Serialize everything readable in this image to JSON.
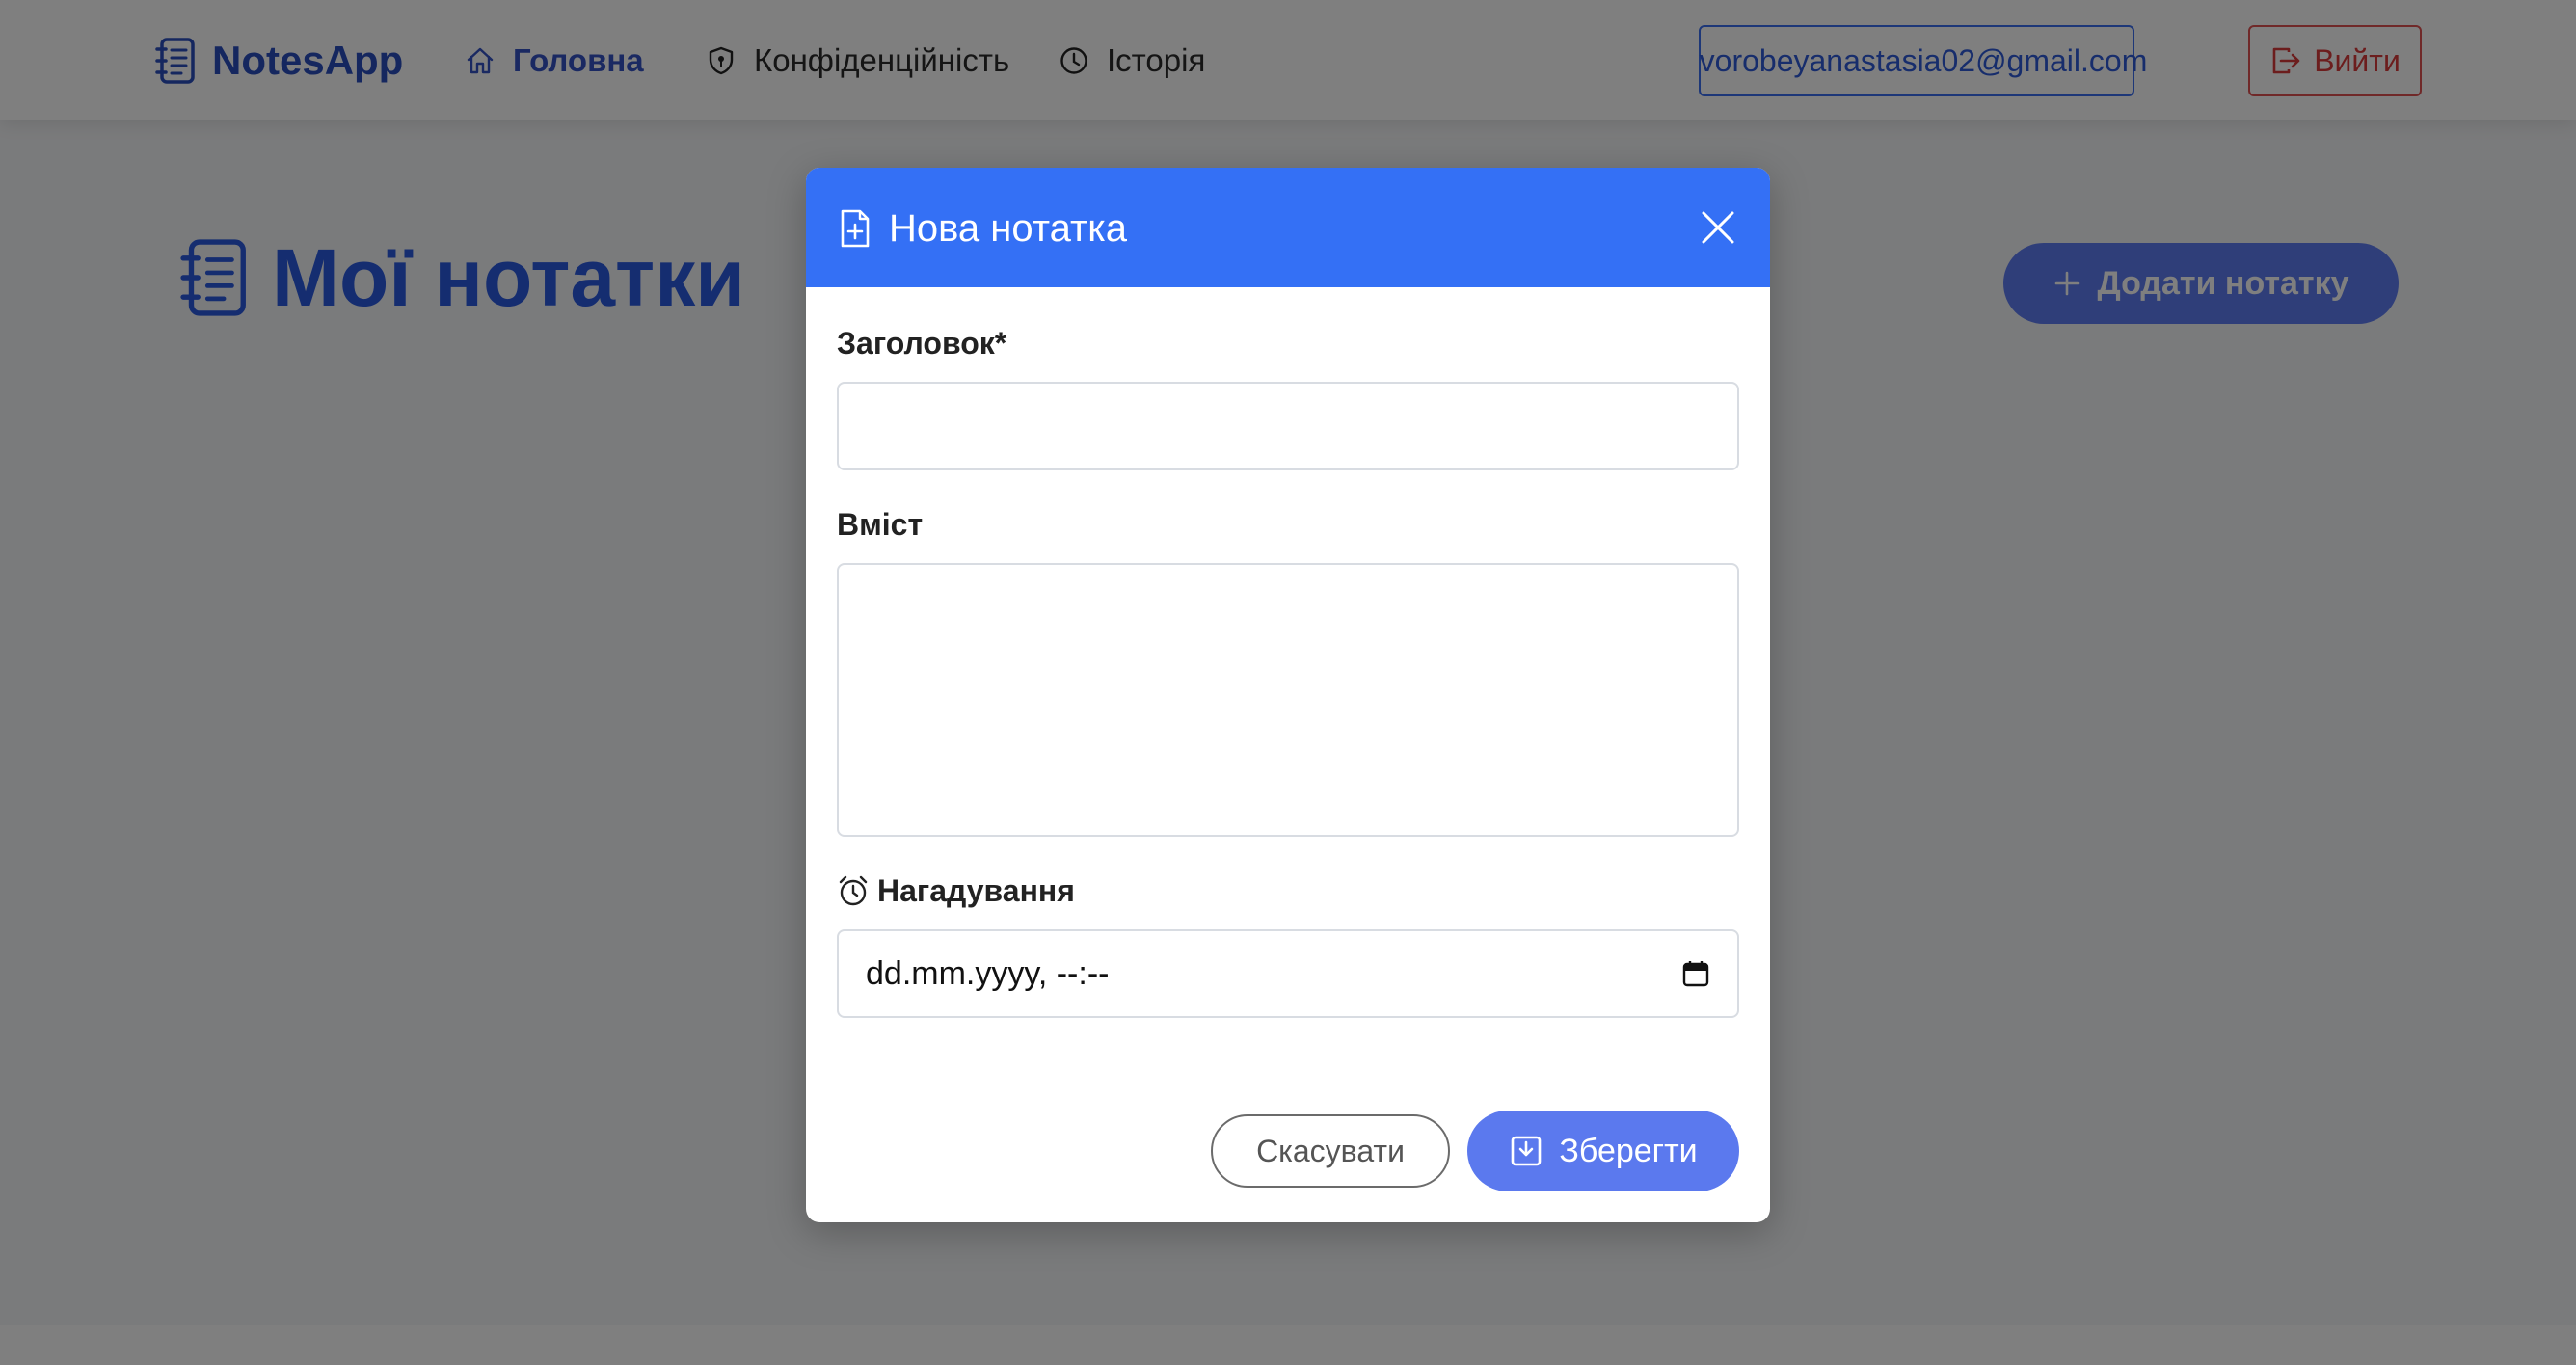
{
  "navbar": {
    "brand": "NotesApp",
    "items": [
      {
        "label": "Головна",
        "icon": "home-icon",
        "active": true
      },
      {
        "label": "Конфіденційність",
        "icon": "shield-icon",
        "active": false
      },
      {
        "label": "Історія",
        "icon": "clock-icon",
        "active": false
      }
    ],
    "user_email": "vorobeyanastasia02@gmail.com",
    "logout_label": "Вийти"
  },
  "main": {
    "title": "Мої нотатки",
    "add_note_label": "Додати нотатку"
  },
  "modal": {
    "title": "Нова нотатка",
    "fields": {
      "title_label": "Заголовок*",
      "title_value": "",
      "content_label": "Вміст",
      "content_value": "",
      "reminder_label": "Нагадування",
      "reminder_placeholder": "dd.mm.yyyy, --:--"
    },
    "cancel_label": "Скасувати",
    "save_label": "Зберегти"
  },
  "colors": {
    "primary": "#3470f5",
    "brand": "#2b4fbf",
    "danger": "#d93b3b",
    "save_button": "#5b79ee",
    "overlay": "rgba(0,0,0,0.5)"
  }
}
